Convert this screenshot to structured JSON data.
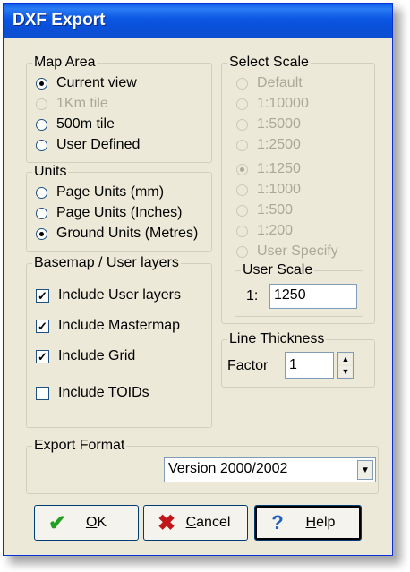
{
  "window": {
    "title": "DXF Export"
  },
  "map_area": {
    "legend": "Map Area",
    "options": [
      {
        "label": "Current view",
        "selected": true,
        "enabled": true
      },
      {
        "label": "1Km tile",
        "selected": false,
        "enabled": false
      },
      {
        "label": "500m tile",
        "selected": false,
        "enabled": true
      },
      {
        "label": "User Defined",
        "selected": false,
        "enabled": true
      }
    ]
  },
  "units": {
    "legend": "Units",
    "options": [
      {
        "label": "Page Units (mm)",
        "selected": false
      },
      {
        "label": "Page Units (Inches)",
        "selected": false
      },
      {
        "label": "Ground Units (Metres)",
        "selected": true
      }
    ]
  },
  "layers": {
    "legend": "Basemap / User layers",
    "options": [
      {
        "label": "Include User layers",
        "checked": true
      },
      {
        "label": "Include Mastermap",
        "checked": true
      },
      {
        "label": "Include Grid",
        "checked": true
      },
      {
        "label": "Include TOIDs",
        "checked": false
      }
    ]
  },
  "scale": {
    "legend": "Select Scale",
    "options": [
      {
        "label": "Default",
        "selected": false
      },
      {
        "label": "1:10000",
        "selected": false
      },
      {
        "label": "1:5000",
        "selected": false
      },
      {
        "label": "1:2500",
        "selected": false
      },
      {
        "label": "1:1250",
        "selected": true
      },
      {
        "label": "1:1000",
        "selected": false
      },
      {
        "label": "1:500",
        "selected": false
      },
      {
        "label": "1:200",
        "selected": false
      },
      {
        "label": "User Specify",
        "selected": false
      }
    ],
    "user_scale": {
      "legend": "User Scale",
      "prefix": "1:",
      "value": "1250"
    }
  },
  "line_thickness": {
    "legend": "Line Thickness",
    "factor_label": "Factor",
    "value": "1"
  },
  "export_format": {
    "legend": "Export Format",
    "value": "Version 2000/2002"
  },
  "buttons": {
    "ok": {
      "label": "OK",
      "mnemonic": "O",
      "rest": "K"
    },
    "cancel": {
      "label": "Cancel",
      "mnemonic": "C",
      "rest": "ancel"
    },
    "help": {
      "label": "Help",
      "mnemonic": "H",
      "rest": "elp"
    }
  },
  "colors": {
    "title_bar": "#0b56e3",
    "face": "#ece9d8",
    "ok_icon": "#21a121",
    "cancel_icon": "#c0161a",
    "help_icon": "#1f5fbf"
  }
}
